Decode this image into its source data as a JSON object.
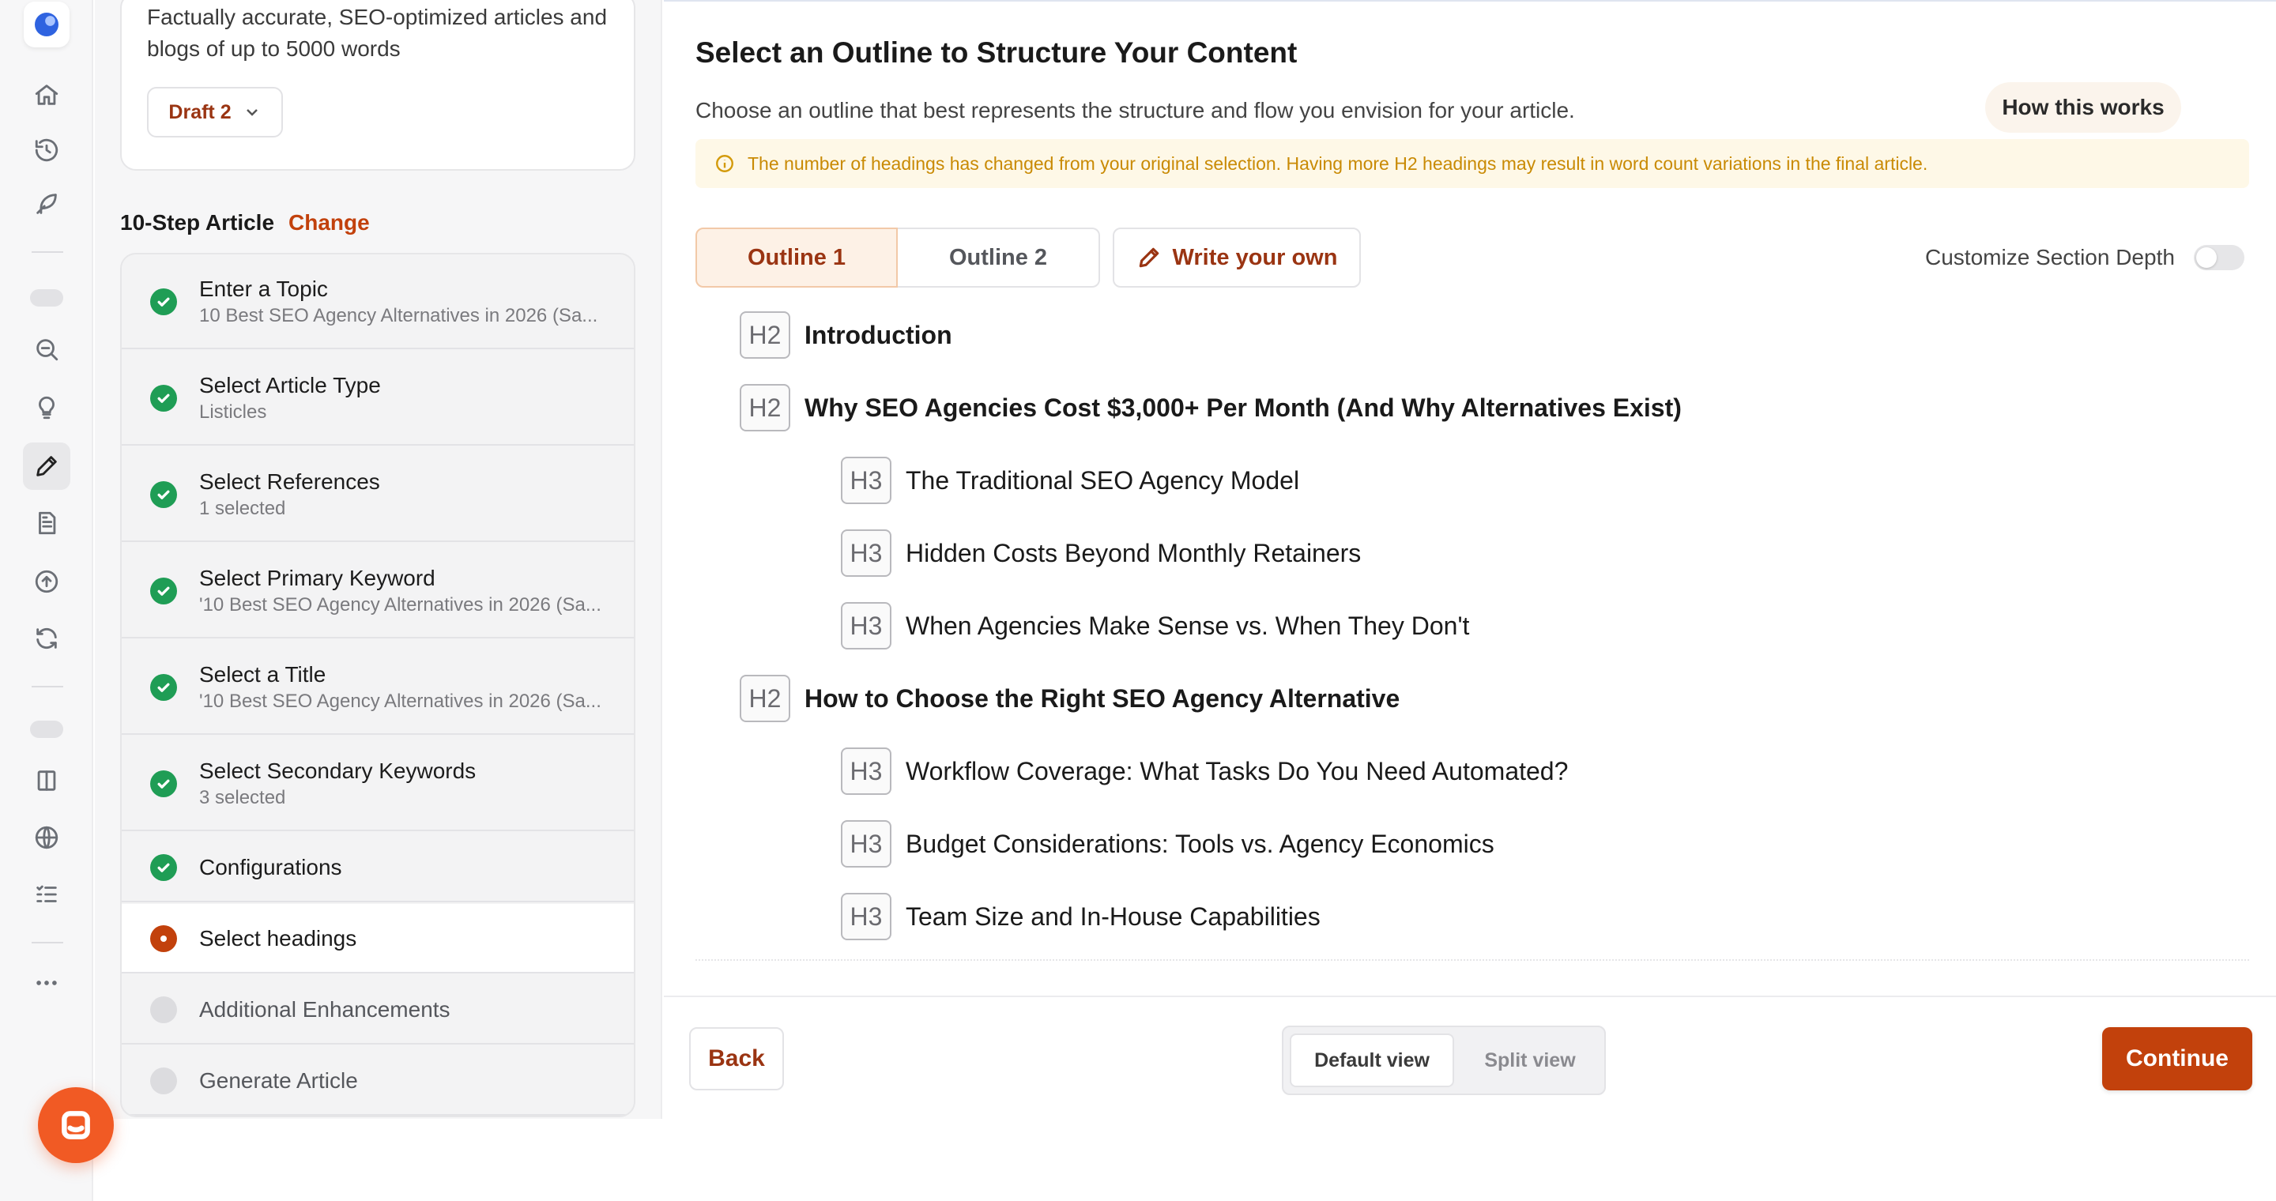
{
  "card": {
    "description": "Factually accurate, SEO-optimized articles and blogs of up to 5000 words",
    "draft_label": "Draft 2"
  },
  "steps_header": {
    "title": "10-Step Article",
    "change_label": "Change"
  },
  "steps": [
    {
      "title": "Enter a Topic",
      "subtitle": "10 Best SEO Agency Alternatives in 2026 (Sa...",
      "status": "done"
    },
    {
      "title": "Select Article Type",
      "subtitle": "Listicles",
      "status": "done"
    },
    {
      "title": "Select References",
      "subtitle": "1 selected",
      "status": "done"
    },
    {
      "title": "Select Primary Keyword",
      "subtitle": "'10 Best SEO Agency Alternatives in 2026 (Sa...",
      "status": "done"
    },
    {
      "title": "Select a Title",
      "subtitle": "'10 Best SEO Agency Alternatives in 2026 (Sa...",
      "status": "done"
    },
    {
      "title": "Select Secondary Keywords",
      "subtitle": "3 selected",
      "status": "done"
    },
    {
      "title": "Configurations",
      "subtitle": "",
      "status": "done"
    },
    {
      "title": "Select headings",
      "subtitle": "",
      "status": "current"
    },
    {
      "title": "Additional Enhancements",
      "subtitle": "",
      "status": "pending"
    },
    {
      "title": "Generate Article",
      "subtitle": "",
      "status": "pending"
    }
  ],
  "main": {
    "title": "Select an Outline to Structure Your Content",
    "subtitle": "Choose an outline that best represents the structure and flow you envision for your article.",
    "how_label": "How this works",
    "warning": "The number of headings has changed from your original selection. Having more H2 headings may result in word count variations in the final article.",
    "tabs": [
      "Outline 1",
      "Outline 2"
    ],
    "active_tab": "Outline 1",
    "write_own_label": "Write your own",
    "depth_label": "Customize Section Depth",
    "depth_enabled": false
  },
  "outline": [
    {
      "level": "H2",
      "text": "Introduction"
    },
    {
      "level": "H2",
      "text": "Why SEO Agencies Cost $3,000+ Per Month (And Why Alternatives Exist)"
    },
    {
      "level": "H3",
      "text": "The Traditional SEO Agency Model"
    },
    {
      "level": "H3",
      "text": "Hidden Costs Beyond Monthly Retainers"
    },
    {
      "level": "H3",
      "text": "When Agencies Make Sense vs. When They Don't"
    },
    {
      "level": "H2",
      "text": "How to Choose the Right SEO Agency Alternative"
    },
    {
      "level": "H3",
      "text": "Workflow Coverage: What Tasks Do You Need Automated?"
    },
    {
      "level": "H3",
      "text": "Budget Considerations: Tools vs. Agency Economics"
    },
    {
      "level": "H3",
      "text": "Team Size and In-House Capabilities"
    }
  ],
  "footer": {
    "back_label": "Back",
    "views": [
      "Default view",
      "Split view"
    ],
    "active_view": "Default view",
    "continue_label": "Continue"
  },
  "colors": {
    "accent": "#c2410c",
    "accent_text": "#9a3412",
    "success": "#1f9d55",
    "warning_text": "#c98a04",
    "warning_bg": "#fef8e7",
    "chat_button": "#f15a24"
  },
  "rail_icons": [
    "home-icon",
    "history-icon",
    "feather-icon",
    "search-icon",
    "lightbulb-icon",
    "pencil-icon",
    "document-icon",
    "upload-icon",
    "refresh-icon",
    "book-icon",
    "globe-icon",
    "checklist-icon",
    "more-icon",
    "chat-icon"
  ]
}
